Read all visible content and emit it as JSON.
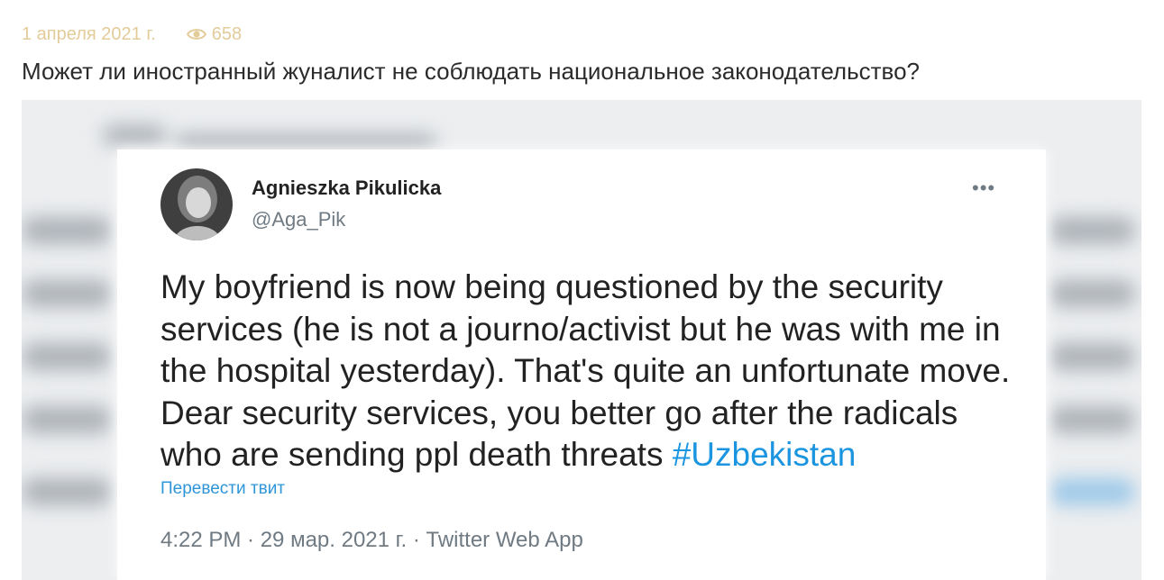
{
  "article": {
    "date": "1 апреля 2021 г.",
    "views": "658",
    "view_icon": "eye-icon",
    "title": "Может ли иностранный жуналист не соблюдать национальное законодательство?"
  },
  "tweet": {
    "author_name": "Agnieszka Pikulicka",
    "author_handle": "@Aga_Pik",
    "more_label": "•••",
    "text": "My boyfriend is now being questioned by the security services (he is not a journo/activist but he was with me in the hospital yesterday). That's quite an unfortunate move. Dear security services, you better go after the radicals who are sending ppl death threats ",
    "hashtag": "#Uzbekistan",
    "translate_label": "Перевести твит",
    "footer": "4:22 PM · 29 мар. 2021 г. · Twitter Web App"
  },
  "colors": {
    "meta": "#e3cb9a",
    "title": "#2b2b2b",
    "link": "#1b95e0",
    "muted": "#6f7a83"
  }
}
